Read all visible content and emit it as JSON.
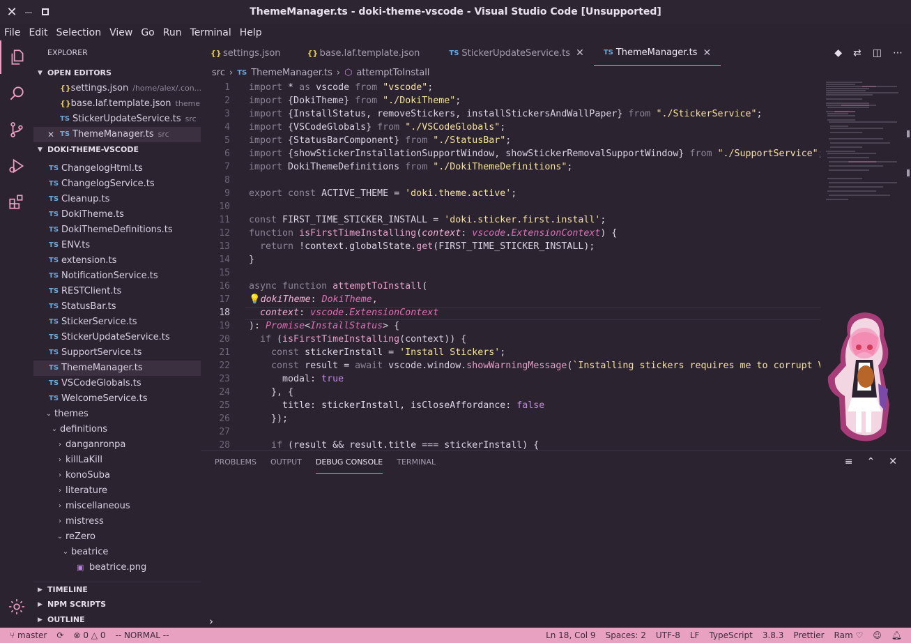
{
  "window": {
    "title": "ThemeManager.ts - doki-theme-vscode - Visual Studio Code [Unsupported]",
    "close_glyph": "✕",
    "maximize_glyph": "□"
  },
  "menu": [
    "File",
    "Edit",
    "Selection",
    "View",
    "Go",
    "Run",
    "Terminal",
    "Help"
  ],
  "activity_bar": {
    "icons": [
      "explorer-icon",
      "search-icon",
      "source-control-icon",
      "run-debug-icon",
      "extensions-icon",
      "settings-gear-icon"
    ]
  },
  "sidebar": {
    "title": "EXPLORER",
    "open_editors": {
      "label": "OPEN EDITORS",
      "items": [
        {
          "icon": "{}",
          "name": "settings.json",
          "desc": "/home/alex/.con..."
        },
        {
          "icon": "{}",
          "name": "base.laf.template.json",
          "desc": "theme..."
        },
        {
          "icon": "TS",
          "name": "StickerUpdateService.ts",
          "desc": "src"
        },
        {
          "icon": "TS",
          "name": "ThemeManager.ts",
          "desc": "src",
          "close": "✕"
        }
      ]
    },
    "project": {
      "label": "DOKI-THEME-VSCODE",
      "files": [
        "ChangelogHtml.ts",
        "ChangelogService.ts",
        "Cleanup.ts",
        "DokiTheme.ts",
        "DokiThemeDefinitions.ts",
        "ENV.ts",
        "extension.ts",
        "NotificationService.ts",
        "RESTClient.ts",
        "StatusBar.ts",
        "StickerService.ts",
        "StickerUpdateService.ts",
        "SupportService.ts",
        "ThemeManager.ts",
        "VSCodeGlobals.ts",
        "WelcomeService.ts"
      ],
      "ts_badge": "TS",
      "folders": {
        "themes": "themes",
        "definitions": "definitions",
        "subfolders": [
          "danganronpa",
          "killLaKill",
          "konoSuba",
          "literature",
          "miscellaneous",
          "mistress"
        ],
        "rezero": "reZero",
        "beatrice": "beatrice",
        "beatrice_file": "beatrice.png"
      }
    },
    "timeline": "TIMELINE",
    "npm_scripts": "NPM SCRIPTS",
    "outline": "OUTLINE"
  },
  "tabs": [
    {
      "icon": "{}",
      "label": "settings.json"
    },
    {
      "icon": "{}",
      "label": "base.laf.template.json"
    },
    {
      "icon": "TS",
      "label": "StickerUpdateService.ts",
      "close": "✕"
    },
    {
      "icon": "TS",
      "label": "ThemeManager.ts",
      "close": "✕"
    }
  ],
  "breadcrumb": {
    "folder": "src",
    "separator": "›",
    "file_icon": "TS",
    "file": "ThemeManager.ts",
    "symbol": "attemptToInstall"
  },
  "editor": {
    "current_line": 18,
    "line_numbers": [
      "1",
      "2",
      "3",
      "4",
      "5",
      "6",
      "7",
      "8",
      "9",
      "10",
      "11",
      "12",
      "13",
      "14",
      "15",
      "16",
      "17",
      "18",
      "19",
      "20",
      "21",
      "22",
      "23",
      "24",
      "25",
      "26",
      "27",
      "28"
    ]
  },
  "panel": {
    "tabs": [
      "PROBLEMS",
      "OUTPUT",
      "DEBUG CONSOLE",
      "TERMINAL"
    ],
    "active_tab": "DEBUG CONSOLE",
    "prompt": "›"
  },
  "statusbar": {
    "branch": "master",
    "errors": "0",
    "warnings": "0",
    "mode": "-- NORMAL --",
    "position": "Ln 18, Col 9",
    "spaces": "Spaces: 2",
    "encoding": "UTF-8",
    "eol": "LF",
    "language": "TypeScript",
    "version": "3.8.3",
    "formatter": "Prettier",
    "ram": "Ram"
  },
  "colors": {
    "accent": "#ec9ec2",
    "status_bar": "#e9a1c2",
    "background": "#2b2330"
  }
}
